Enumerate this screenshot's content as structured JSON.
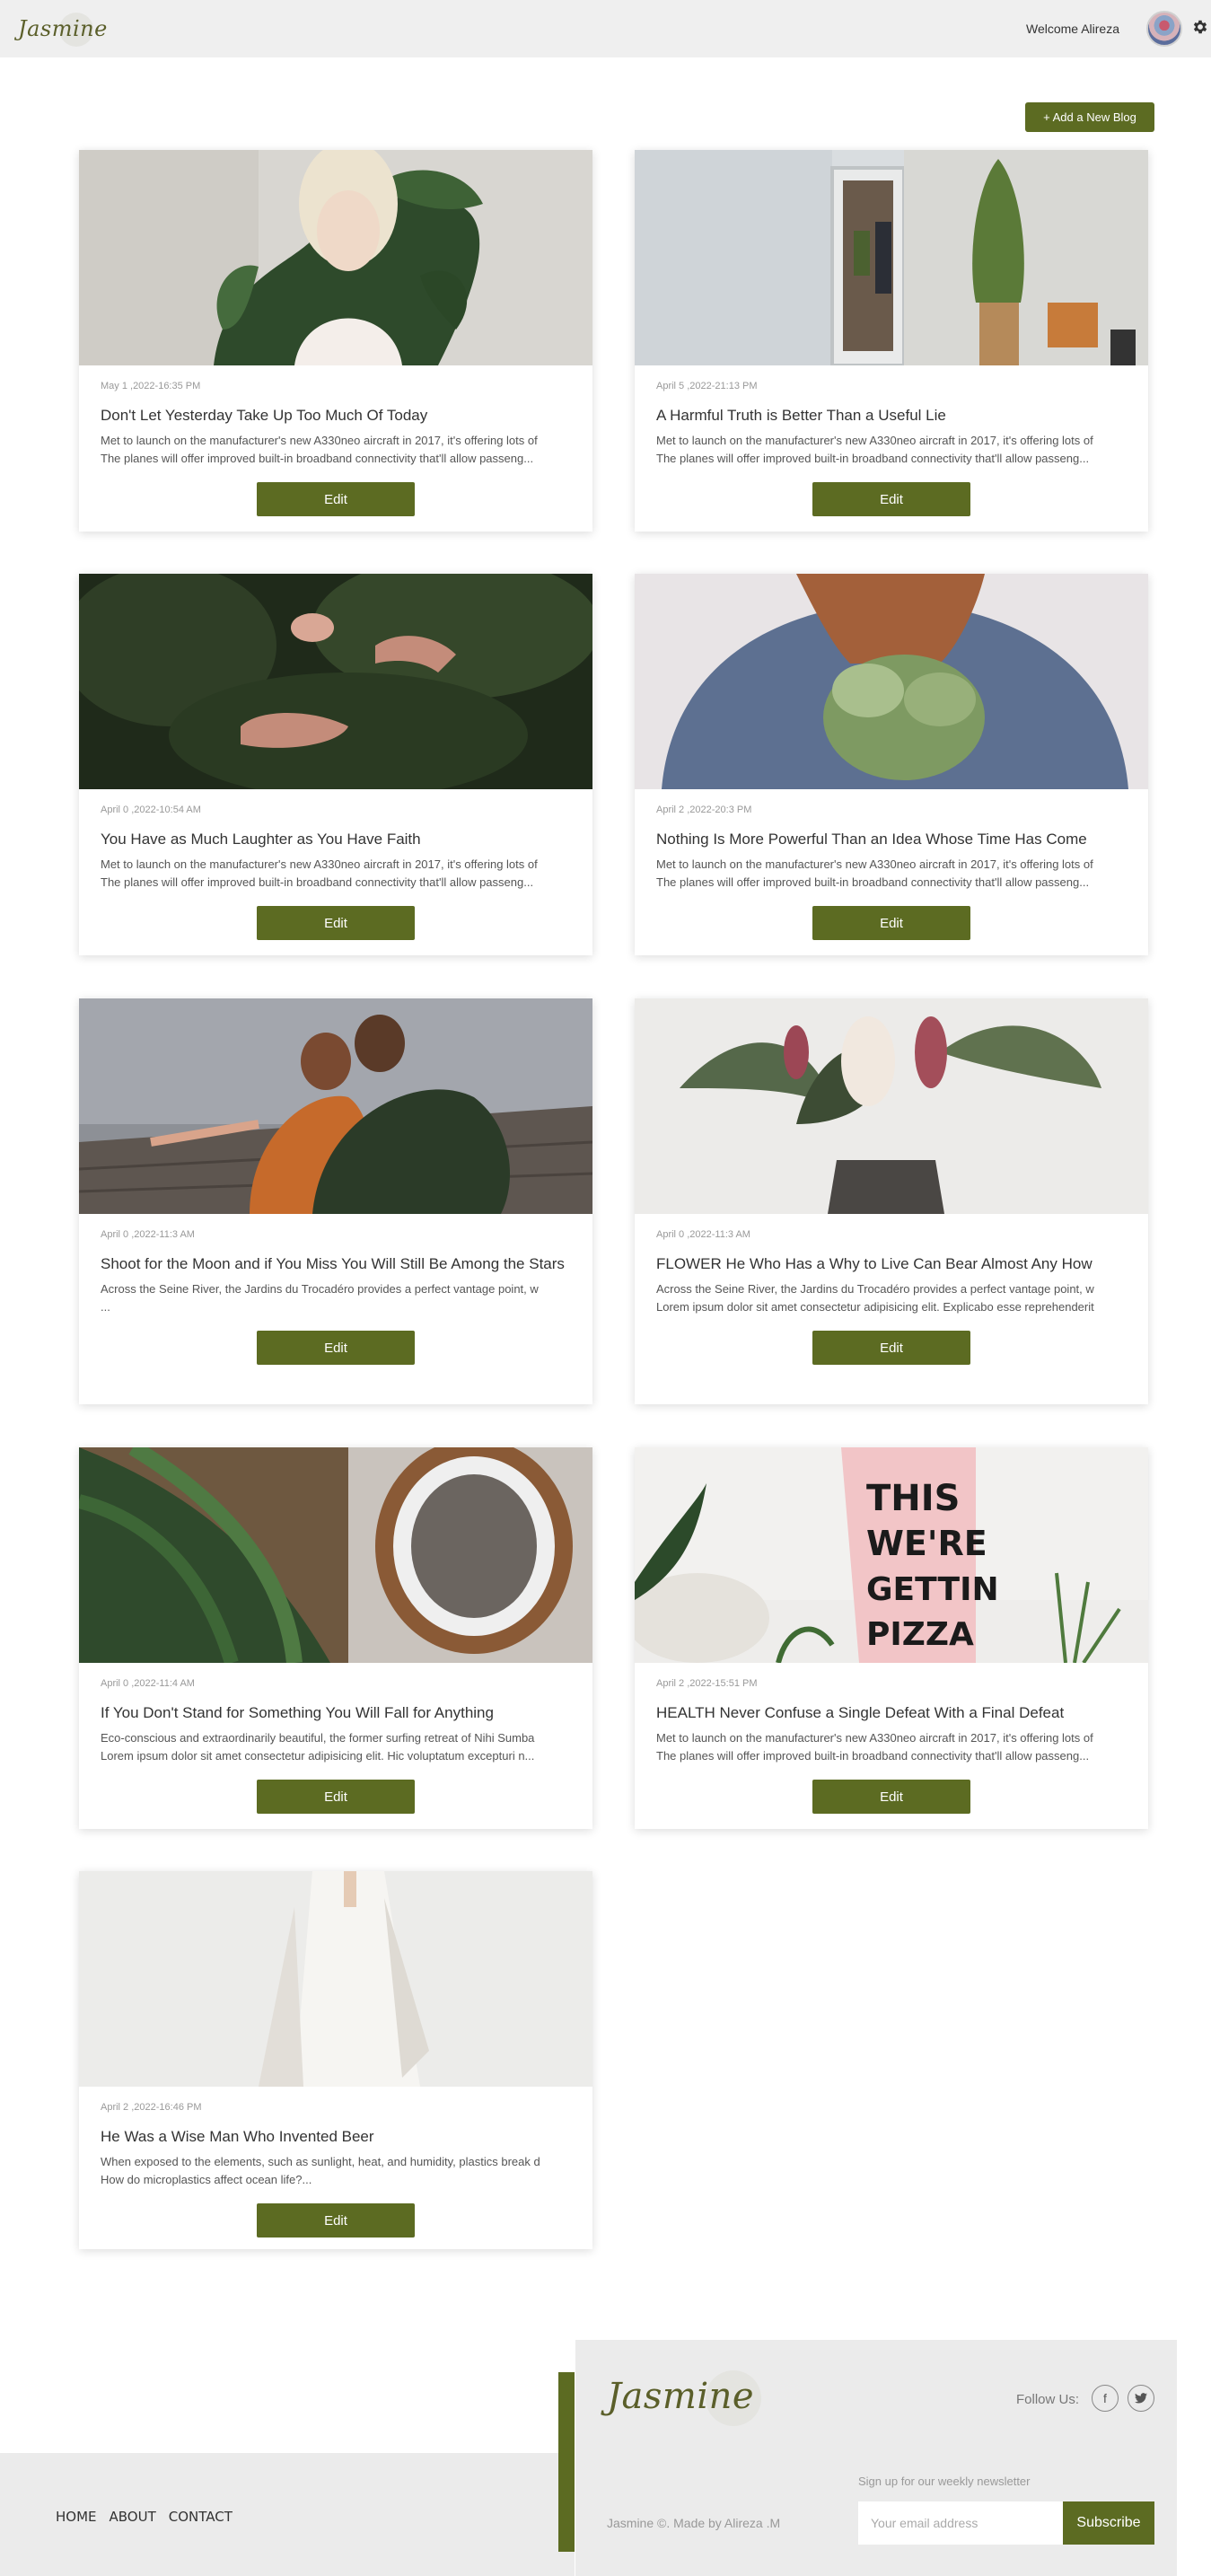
{
  "header": {
    "logo": "Jasmine",
    "welcome": "Welcome Alireza",
    "avatar_icon": "user-avatar",
    "settings_icon": "gear-icon"
  },
  "actions": {
    "add_blog": "+ Add a New Blog"
  },
  "colors": {
    "accent": "#5c6b22",
    "header_bg": "#efefef",
    "footer_bg": "#ebebeb"
  },
  "posts": [
    {
      "date": "May 1 ,2022-16:35 PM",
      "title": "Don't Let Yesterday Take Up Too Much Of Today",
      "excerpt": [
        "Met to launch on the manufacturer's new A330neo aircraft in 2017, it's offering lots of",
        "The planes will offer improved built-in broadband connectivity that'll allow passeng..."
      ],
      "edit": "Edit",
      "image": "woman-with-plant"
    },
    {
      "date": "April 5 ,2022-21:13 PM",
      "title": "A Harmful Truth is Better Than a Useful Lie",
      "excerpt": [
        "Met to launch on the manufacturer's new A330neo aircraft in 2017, it's offering lots of",
        "The planes will offer improved built-in broadband connectivity that'll allow passeng..."
      ],
      "edit": "Edit",
      "image": "office-booth"
    },
    {
      "date": "April 0 ,2022-10:54 AM",
      "title": "You Have as Much Laughter as You Have Faith",
      "excerpt": [
        "Met to launch on the manufacturer's new A330neo aircraft in 2017, it's offering lots of",
        "The planes will offer improved built-in broadband connectivity that'll allow passeng..."
      ],
      "edit": "Edit",
      "image": "hands-in-leaves"
    },
    {
      "date": "April 2 ,2022-20:3 PM",
      "title": "Nothing Is More Powerful Than an Idea Whose Time Has Come",
      "excerpt": [
        "Met to launch on the manufacturer's new A330neo aircraft in 2017, it's offering lots of",
        "The planes will offer improved built-in broadband connectivity that'll allow passeng..."
      ],
      "edit": "Edit",
      "image": "blue-sweater-bouquet"
    },
    {
      "date": "April 0 ,2022-11:3 AM",
      "title": "Shoot for the Moon and if You Miss You Will Still Be Among the Stars",
      "excerpt": [
        "Across the Seine River, the Jardins du Trocadéro provides a perfect vantage point, w",
        "..."
      ],
      "edit": "Edit",
      "image": "friends-at-lake"
    },
    {
      "date": "April 0 ,2022-11:3 AM",
      "title": "FLOWER He Who Has a Why to Live Can Bear Almost Any How",
      "excerpt": [
        "Across the Seine River, the Jardins du Trocadéro provides a perfect vantage point, w",
        "Lorem ipsum dolor sit amet consectetur adipisicing elit. Explicabo esse reprehenderit"
      ],
      "edit": "Edit",
      "image": "flowers-vase"
    },
    {
      "date": "April 0 ,2022-11:4 AM",
      "title": "If You Don't Stand for Something You Will Fall for Anything",
      "excerpt": [
        "Eco-conscious and extraordinarily beautiful, the former surfing retreat of Nihi Sumba",
        "Lorem ipsum dolor sit amet consectetur adipisicing elit. Hic voluptatum excepturi n..."
      ],
      "edit": "Edit",
      "image": "coffee-and-plant"
    },
    {
      "date": "April 2 ,2022-15:51 PM",
      "title": "HEALTH Never Confuse a Single Defeat With a Final Defeat",
      "excerpt": [
        "Met to launch on the manufacturer's new A330neo aircraft in 2017, it's offering lots of",
        "The planes will offer improved built-in broadband connectivity that'll allow passeng..."
      ],
      "edit": "Edit",
      "image": "pizza-dress"
    },
    {
      "date": "April 2 ,2022-16:46 PM",
      "title": "He Was a Wise Man Who Invented Beer",
      "excerpt": [
        "When exposed to the elements, such as sunlight, heat, and humidity, plastics break d",
        "How do microplastics affect ocean life?..."
      ],
      "edit": "Edit",
      "image": "woman-in-white"
    }
  ],
  "footer": {
    "nav": [
      "HOME",
      "ABOUT",
      "CONTACT"
    ],
    "logo": "Jasmine",
    "follow": "Follow Us:",
    "social": [
      "facebook-icon",
      "twitter-icon"
    ],
    "copyright": "Jasmine ©. Made by Alireza .M",
    "newsletter_label": "Sign up for our weekly newsletter",
    "email_placeholder": "Your email address",
    "subscribe": "Subscribe"
  }
}
